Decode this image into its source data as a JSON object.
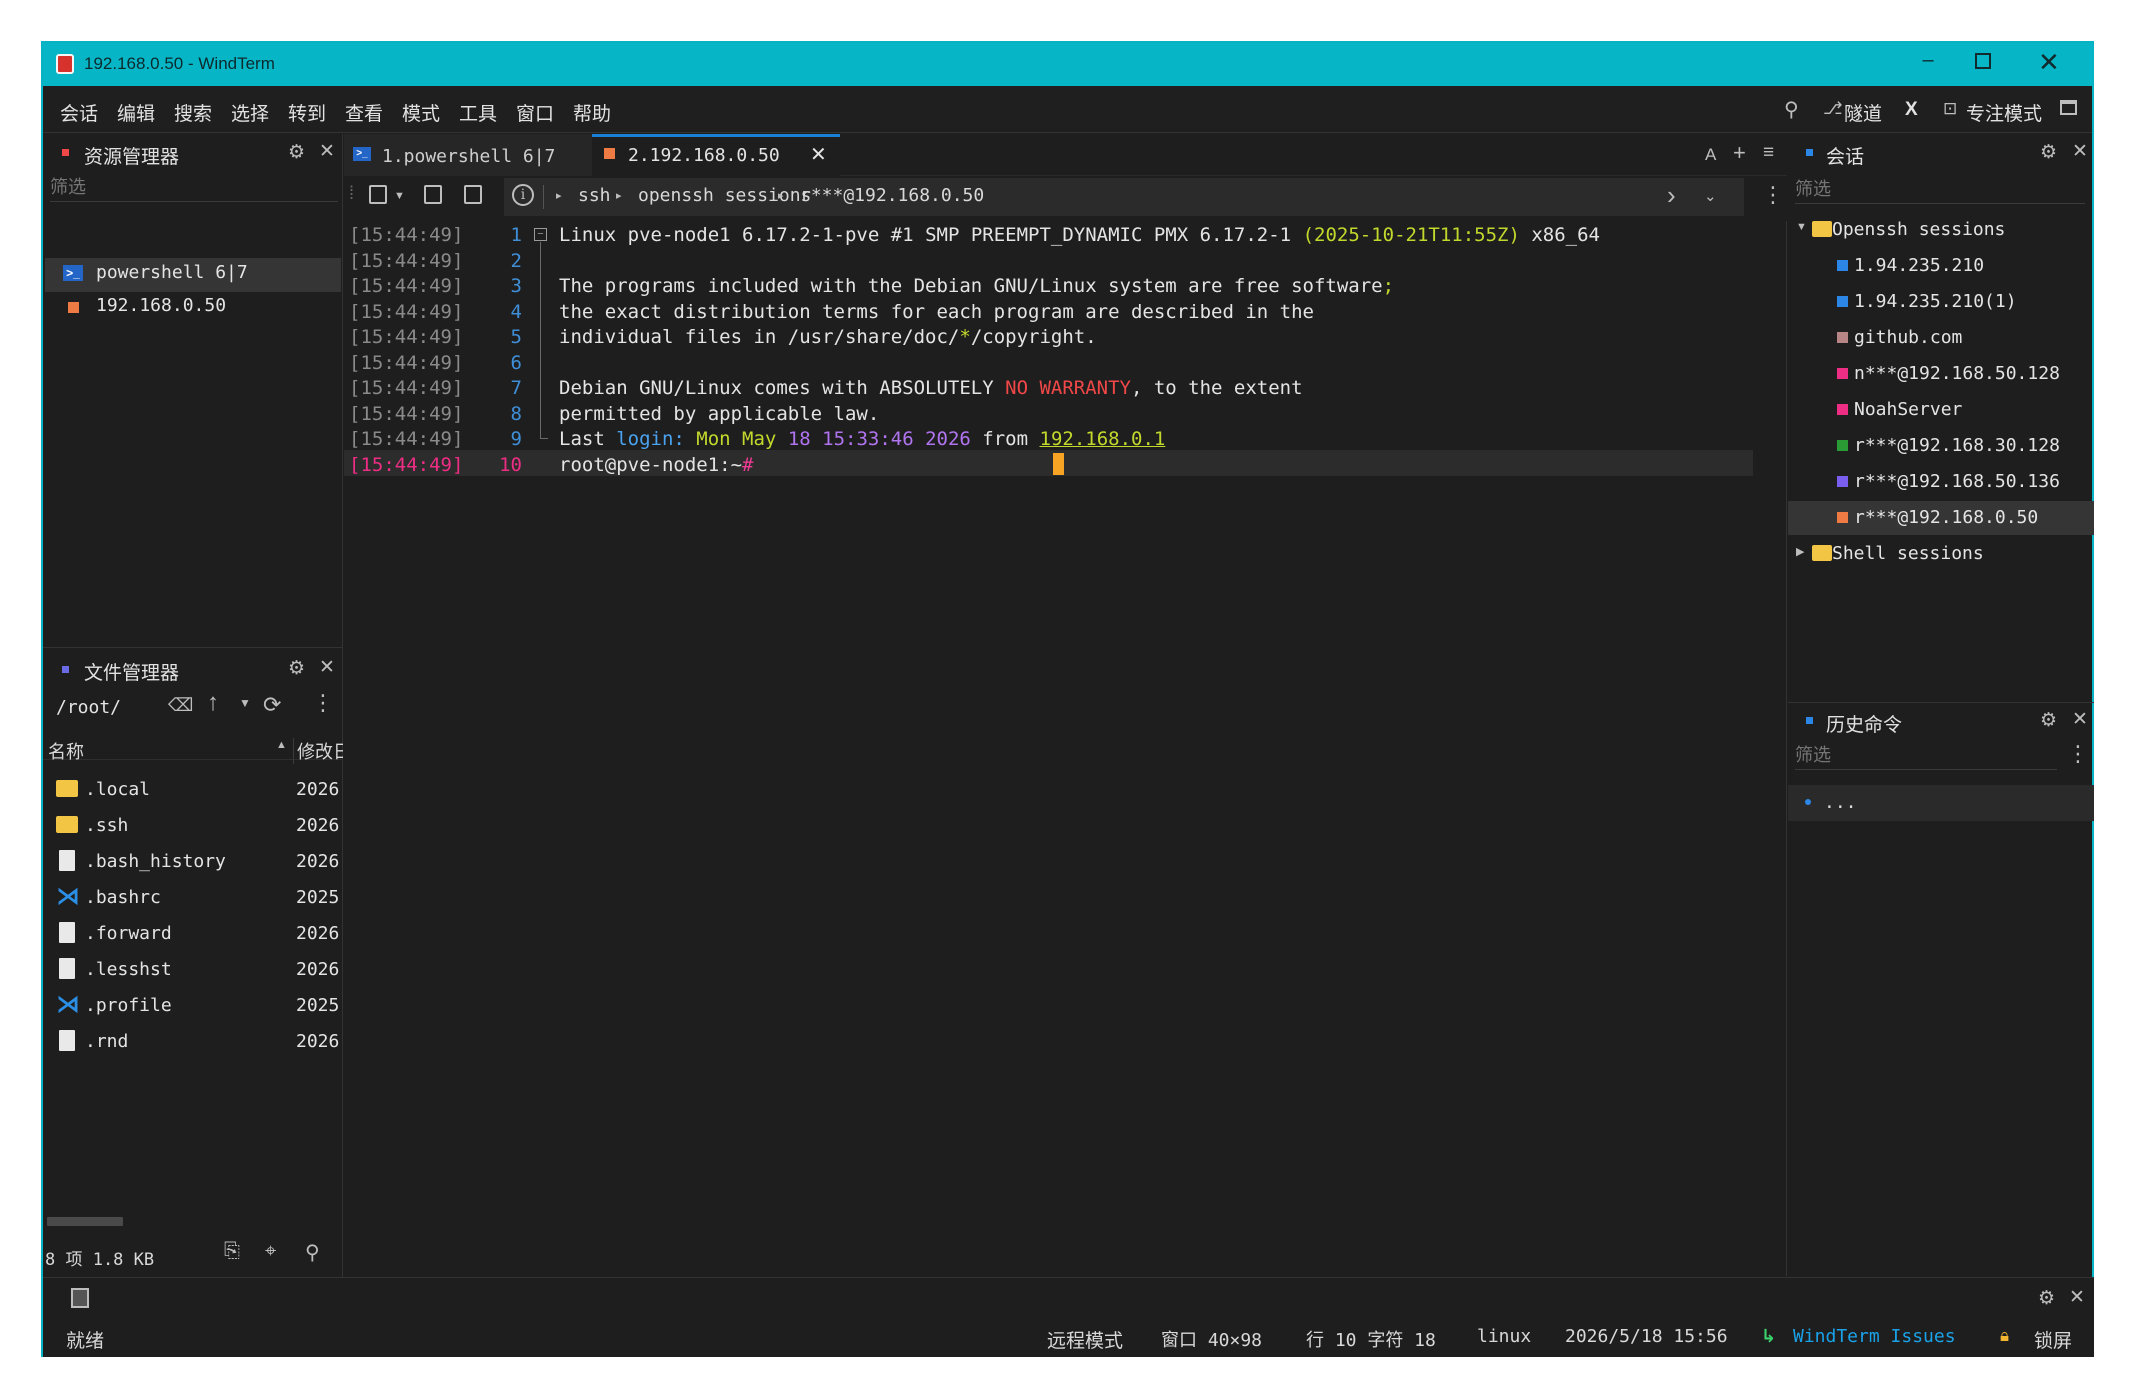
{
  "window": {
    "title": "192.168.0.50 - WindTerm"
  },
  "menu": [
    "会话",
    "编辑",
    "搜索",
    "选择",
    "转到",
    "查看",
    "模式",
    "工具",
    "窗口",
    "帮助"
  ],
  "right_toolbar": {
    "tunnel": "隧道",
    "x_label": "X",
    "focus_mode": "专注模式"
  },
  "explorer": {
    "title": "资源管理器",
    "filter_placeholder": "筛选",
    "items": [
      {
        "label": "powershell 6|7",
        "icon": "powershell-icon"
      },
      {
        "label": "192.168.0.50",
        "icon": "orange-square-icon"
      }
    ]
  },
  "file_manager": {
    "title": "文件管理器",
    "path": "/root/",
    "col_name": "名称",
    "col_modified": "修改日",
    "files": [
      {
        "name": ".local",
        "date": "2026",
        "icon": "folder-icon"
      },
      {
        "name": ".ssh",
        "date": "2026",
        "icon": "folder-icon"
      },
      {
        "name": ".bash_history",
        "date": "2026",
        "icon": "file-icon"
      },
      {
        "name": ".bashrc",
        "date": "2025",
        "icon": "vscode-icon"
      },
      {
        "name": ".forward",
        "date": "2026",
        "icon": "file-icon"
      },
      {
        "name": ".lesshst",
        "date": "2026",
        "icon": "file-icon"
      },
      {
        "name": ".profile",
        "date": "2025",
        "icon": "vscode-icon"
      },
      {
        "name": ".rnd",
        "date": "2026",
        "icon": "file-icon"
      }
    ],
    "footer": "8 项 1.8 KB"
  },
  "tabs": [
    {
      "label": "1.powershell 6|7",
      "active": false
    },
    {
      "label": "2.192.168.0.50",
      "active": true
    }
  ],
  "tab_tools": {
    "font": "A",
    "add": "+",
    "menu": "≡"
  },
  "breadcrumb": [
    "ssh",
    "openssh sessions",
    "r***@192.168.0.50"
  ],
  "terminal": {
    "timestamp": "[15:44:49]",
    "lines": [
      {
        "n": "1",
        "segs": [
          {
            "t": "Linux pve-node1 6.17.2-1-pve ",
            "c": "#e4e4e4"
          },
          {
            "t": "#1",
            "c": "#e4e4e4"
          },
          {
            "t": " SMP PREEMPT_DYNAMIC PMX 6.17.2-1 ",
            "c": "#e4e4e4"
          },
          {
            "t": "(2025-10-21T11:55Z)",
            "c": "#c3d82c"
          },
          {
            "t": " x86_64",
            "c": "#e4e4e4"
          }
        ]
      },
      {
        "n": "2",
        "segs": []
      },
      {
        "n": "3",
        "segs": [
          {
            "t": "The programs included with the Debian GNU/Linux system are free software",
            "c": "#e4e4e4"
          },
          {
            "t": ";",
            "c": "#c3d82c"
          }
        ]
      },
      {
        "n": "4",
        "segs": [
          {
            "t": "the exact distribution terms for each program are described in the",
            "c": "#e4e4e4"
          }
        ]
      },
      {
        "n": "5",
        "segs": [
          {
            "t": "individual files in /usr/share/doc/",
            "c": "#e4e4e4"
          },
          {
            "t": "*",
            "c": "#c3d82c"
          },
          {
            "t": "/copyright.",
            "c": "#e4e4e4"
          }
        ]
      },
      {
        "n": "6",
        "segs": []
      },
      {
        "n": "7",
        "segs": [
          {
            "t": "Debian GNU/Linux comes with ABSOLUTELY ",
            "c": "#e4e4e4"
          },
          {
            "t": "NO WARRANTY",
            "c": "#f04848"
          },
          {
            "t": ", to the extent",
            "c": "#e4e4e4"
          }
        ]
      },
      {
        "n": "8",
        "segs": [
          {
            "t": "permitted by applicable law.",
            "c": "#e4e4e4"
          }
        ]
      },
      {
        "n": "9",
        "segs": [
          {
            "t": "Last ",
            "c": "#e4e4e4"
          },
          {
            "t": "login:",
            "c": "#4aa3f0"
          },
          {
            "t": " ",
            "c": "#e4e4e4"
          },
          {
            "t": "Mon May",
            "c": "#c3d82c"
          },
          {
            "t": " ",
            "c": "#e4e4e4"
          },
          {
            "t": "18 15:33:46 2026",
            "c": "#b174f0"
          },
          {
            "t": " from ",
            "c": "#e4e4e4"
          },
          {
            "t": "192.168.0.1",
            "c": "#c3d82c"
          }
        ]
      },
      {
        "n": "10",
        "segs": [
          {
            "t": "root@pve-node1:~",
            "c": "#e4e4e4"
          },
          {
            "t": "#",
            "c": "#ee3b94"
          },
          {
            "t": " ",
            "c": "#e4e4e4"
          }
        ]
      }
    ]
  },
  "sessions": {
    "title": "会话",
    "filter_placeholder": "筛选",
    "groups": [
      {
        "name": "Openssh sessions",
        "expanded": true,
        "items": [
          {
            "label": "1.94.235.210",
            "color": "#2b86e6"
          },
          {
            "label": "1.94.235.210(1)",
            "color": "#2b86e6"
          },
          {
            "label": "github.com",
            "color": "#b88586"
          },
          {
            "label": "n***@192.168.50.128",
            "color": "#ee2d84"
          },
          {
            "label": "NoahServer",
            "color": "#ee2d84"
          },
          {
            "label": "r***@192.168.30.128",
            "color": "#2a9a34"
          },
          {
            "label": "r***@192.168.50.136",
            "color": "#7a5ef0"
          },
          {
            "label": "r***@192.168.0.50",
            "color": "#ee7b44"
          }
        ]
      },
      {
        "name": "Shell sessions",
        "expanded": false,
        "items": []
      }
    ]
  },
  "history": {
    "title": "历史命令",
    "filter_placeholder": "筛选",
    "items": [
      "..."
    ]
  },
  "status": {
    "ready": "就绪",
    "remote_mode": "远程模式",
    "window_size": "窗口 40×98",
    "position": "行 10 字符 18",
    "os": "linux",
    "datetime": "2026/5/18 15:56",
    "issues": "WindTerm Issues",
    "lock": "锁屏"
  }
}
